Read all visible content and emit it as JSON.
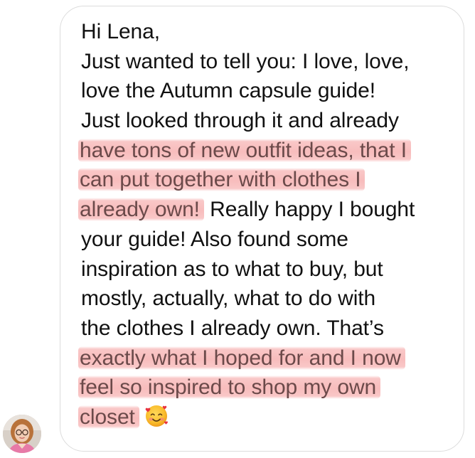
{
  "message": {
    "lines": [
      {
        "text": "Hi Lena,",
        "highlight": false
      },
      {
        "text": "Just wanted to tell you: I love, love,",
        "highlight": false
      },
      {
        "text": "love the Autumn capsule guide!",
        "highlight": false
      },
      {
        "text": "Just looked through it and already",
        "highlight": false
      },
      {
        "text": "have tons of new outfit ideas, that I",
        "highlight": true
      },
      {
        "text": "can put together with clothes I",
        "highlight": true
      },
      {
        "text": "already own!",
        "highlight": true,
        "rest": " Really happy I bought"
      },
      {
        "text": "your guide! Also found some",
        "highlight": false
      },
      {
        "text": "inspiration as to what to buy, but",
        "highlight": false
      },
      {
        "text": "mostly, actually, what to do with",
        "highlight": false
      },
      {
        "text": "the clothes I already own. That’s",
        "highlight": false
      },
      {
        "text": "exactly what I hoped for and I now",
        "highlight": true
      },
      {
        "text": "feel so inspired to shop my own",
        "highlight": true
      },
      {
        "text": "closet",
        "highlight": true,
        "emoji": "smiling-face-with-hearts-icon"
      }
    ]
  },
  "colors": {
    "highlight": "#f6aaaa",
    "text": "#111111",
    "bubble_border": "#dcdcdc"
  },
  "avatar": {
    "icon": "sender-avatar"
  }
}
